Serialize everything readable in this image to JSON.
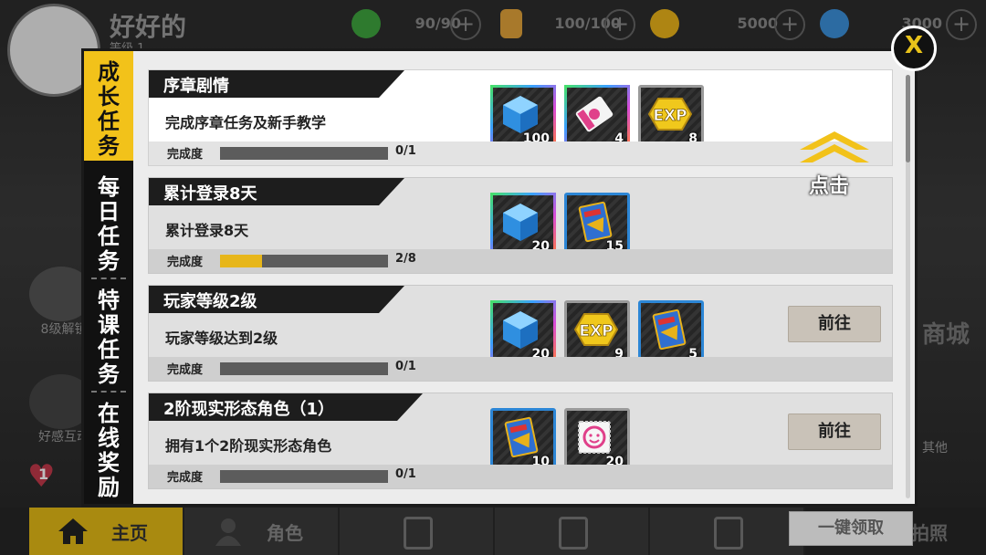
{
  "header": {
    "player_name": "好好的",
    "player_level": "等级 1",
    "resources": [
      {
        "name": "stamina",
        "value": "90/90",
        "icon": "leaf-icon",
        "color": "#3ea33e"
      },
      {
        "name": "energy",
        "value": "100/100",
        "icon": "battery-icon",
        "color": "#e0a23a"
      },
      {
        "name": "coins",
        "value": "5000",
        "icon": "coin-icon",
        "color": "#e8b21a"
      },
      {
        "name": "gems",
        "value": "3000",
        "icon": "gem-icon",
        "color": "#3b8fd9"
      }
    ]
  },
  "side": {
    "unlock_label": "8级解锁",
    "affinity_label": "好感互动",
    "affinity_count": "1",
    "other_label": "其他",
    "shop_label": "商城"
  },
  "bottom_nav": {
    "home": "主页",
    "character": "角色",
    "photo": "拍照"
  },
  "dialog": {
    "tabs": [
      {
        "label": "成长任务",
        "active": true
      },
      {
        "label": "每日任务",
        "active": false
      },
      {
        "label": "特课任务",
        "active": false
      },
      {
        "label": "在线奖励",
        "active": false
      }
    ],
    "close_label": "X",
    "claim_all_label": "一键领取",
    "hint_text": "点击",
    "progress_label": "完成度",
    "goto_label": "前往",
    "tasks": [
      {
        "title": "序章剧情",
        "desc": "完成序章任务及新手教学",
        "progress": "0/1",
        "progress_fraction": 0,
        "highlighted": true,
        "rewards": [
          {
            "icon": "blue-cube-icon",
            "count": "100",
            "frame": "rainbow"
          },
          {
            "icon": "pink-ticket-icon",
            "count": "4",
            "frame": "rainbow"
          },
          {
            "icon": "exp-hexagon-icon",
            "count": "8",
            "frame": "gray"
          }
        ]
      },
      {
        "title": "累计登录8天",
        "desc": "累计登录8天",
        "progress": "2/8",
        "progress_fraction": 0.25,
        "highlighted": false,
        "rewards": [
          {
            "icon": "blue-cube-icon",
            "count": "20",
            "frame": "rainbow"
          },
          {
            "icon": "blue-card-icon",
            "count": "15",
            "frame": "blue"
          }
        ]
      },
      {
        "title": "玩家等级2级",
        "desc": "玩家等级达到2级",
        "progress": "0/1",
        "progress_fraction": 0,
        "highlighted": false,
        "has_goto": true,
        "rewards": [
          {
            "icon": "blue-cube-icon",
            "count": "20",
            "frame": "rainbow"
          },
          {
            "icon": "exp-hexagon-icon",
            "count": "9",
            "frame": "gray"
          },
          {
            "icon": "blue-card-icon",
            "count": "5",
            "frame": "blue"
          }
        ]
      },
      {
        "title": "2阶现实形态角色（1）",
        "desc": "拥有1个2阶现实形态角色",
        "progress": "0/1",
        "progress_fraction": 0,
        "highlighted": false,
        "has_goto": true,
        "rewards": [
          {
            "icon": "blue-card-icon",
            "count": "10",
            "frame": "blue"
          },
          {
            "icon": "smile-stamp-icon",
            "count": "20",
            "frame": "gray"
          }
        ]
      }
    ]
  }
}
